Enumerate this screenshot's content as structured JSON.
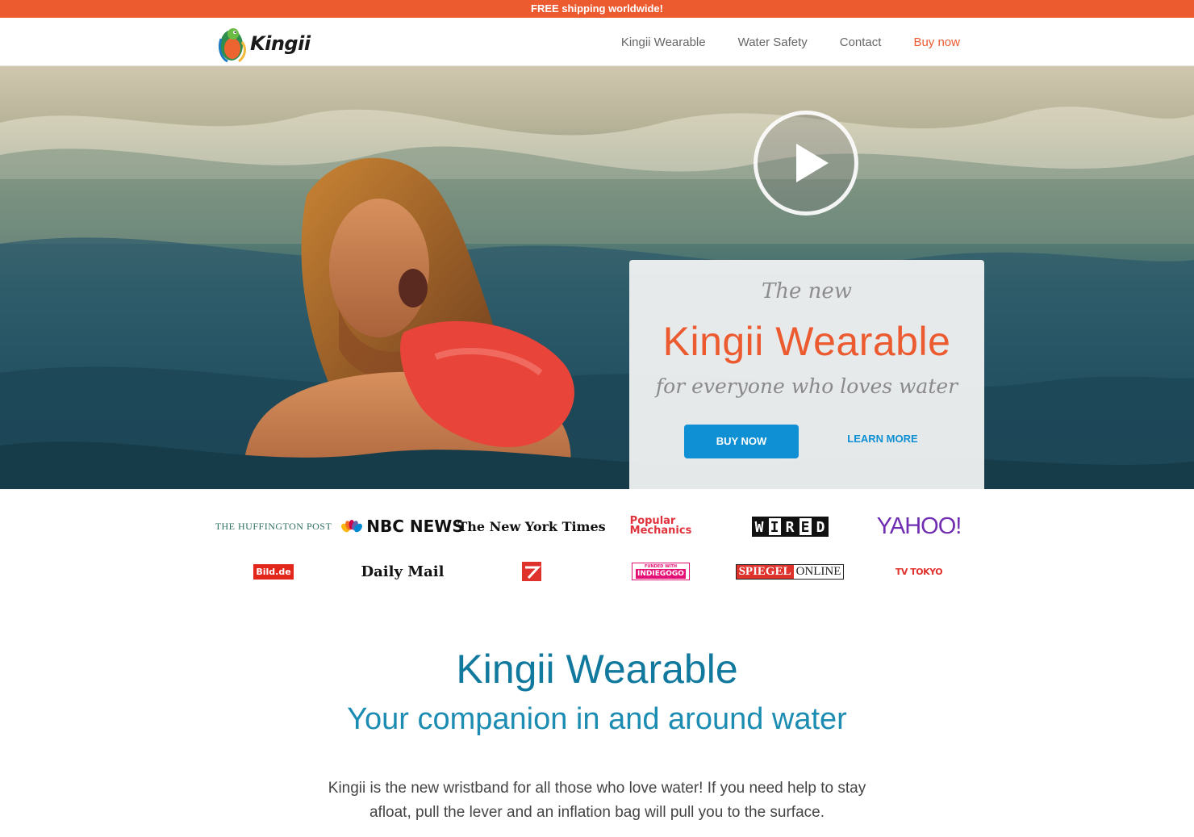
{
  "promo_bar": {
    "text": "FREE shipping worldwide!"
  },
  "nav": {
    "logo_text": "Kingii",
    "links": [
      "Kingii Wearable",
      "Water Safety",
      "Contact",
      "Buy now"
    ]
  },
  "hero": {
    "kicker": "The new",
    "title": "Kingii Wearable",
    "subtitle": "for everyone who loves water",
    "buy_button": "BUY NOW",
    "learn_button": "LEARN MORE"
  },
  "press": {
    "huffpost": "THE HUFFINGTON POST",
    "nbc": "NBC NEWS",
    "nyt": "The New York Times",
    "popmech_line1": "Popular",
    "popmech_line2": "Mechanics",
    "wired_letters": [
      "W",
      "I",
      "R",
      "E",
      "D"
    ],
    "yahoo": "YAHOO!",
    "bild": "Bild.de",
    "dailymail": "Daily Mail",
    "indiegogo_small": "FUNDED WITH",
    "indiegogo_big": "INDIEGOGO",
    "spiegel_a": "SPIEGEL",
    "spiegel_b": "ONLINE",
    "tvtokyo": "TV TOKYO"
  },
  "section": {
    "title": "Kingii Wearable",
    "subtitle": "Your companion in and around water",
    "body": "Kingii is the new wristband for all those who love water! If you need help to stay afloat, pull the lever and an inflation bag will pull you to the surface."
  },
  "colors": {
    "accent_orange": "#ec5a30",
    "accent_blue": "#0f8fd4",
    "section_blue": "#11789e"
  },
  "icons": [
    "kingii-logo-icon",
    "play-icon",
    "nbc-peacock-icon",
    "prosieben-icon"
  ]
}
